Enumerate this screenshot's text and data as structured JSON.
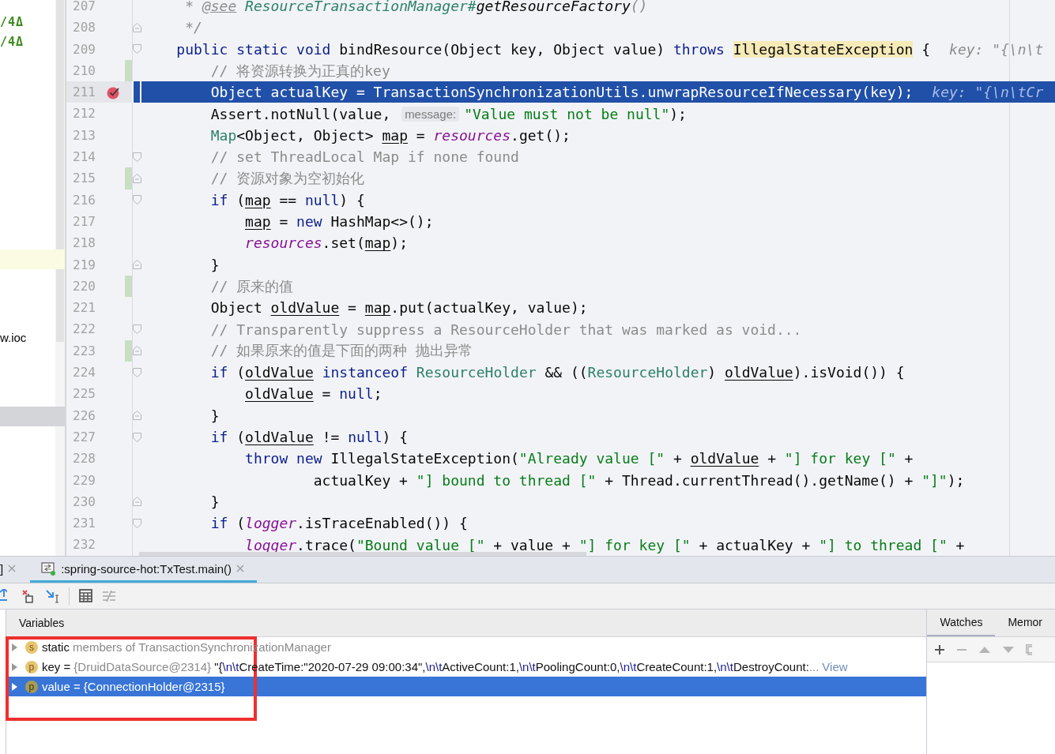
{
  "project_panel": {
    "rows": [
      {
        "text": "/4Δ",
        "current": false,
        "selected": false
      },
      {
        "text": "/4Δ",
        "current": false,
        "selected": false
      },
      {
        "current": true,
        "selected": false
      },
      {
        "text": "w.ioc",
        "current": false,
        "selected": false
      },
      {
        "current": false,
        "selected": true
      }
    ]
  },
  "editor": {
    "lines": [
      {
        "number": "207",
        "selected": false,
        "breakpoint": false,
        "changed": false,
        "fold_start": false,
        "fold_end": false,
        "tokens": [
          {
            "kind": "doc",
            "text": "     * "
          },
          {
            "kind": "doc-tag",
            "text": "@see"
          },
          {
            "kind": "doc-link",
            "text": " ResourceTransactionManager#"
          },
          {
            "kind": "doc-ref",
            "text": "getResourceFactory"
          },
          {
            "kind": "doc",
            "text": "()"
          }
        ]
      },
      {
        "number": "208",
        "selected": false,
        "breakpoint": false,
        "changed": false,
        "fold_start": false,
        "fold_end": true,
        "tokens": [
          {
            "kind": "doc",
            "text": "     */"
          }
        ]
      },
      {
        "number": "209",
        "selected": false,
        "breakpoint": false,
        "changed": false,
        "fold_start": true,
        "fold_end": false,
        "tokens": [
          {
            "kind": "keyword",
            "text": "    public static void"
          },
          {
            "kind": "plain",
            "text": " bindResource(Object key, Object value) "
          },
          {
            "kind": "keyword",
            "text": "throws "
          },
          {
            "kind": "match",
            "text": "IllegalStateException"
          },
          {
            "kind": "plain",
            "text": " {"
          },
          {
            "kind": "hint",
            "text": "key: \"{\\n\\t"
          }
        ]
      },
      {
        "number": "210",
        "selected": false,
        "breakpoint": false,
        "changed": true,
        "fold_start": false,
        "fold_end": false,
        "tokens": [
          {
            "kind": "comment",
            "text": "        // 将资源转换为正真的key"
          }
        ]
      },
      {
        "number": "211",
        "selected": true,
        "breakpoint": true,
        "changed": false,
        "fold_start": false,
        "fold_end": false,
        "tokens": [
          {
            "kind": "plain",
            "text": "        Object actualKey = TransactionSynchronizationUtils.unwrapResourceIfNecessary(key);"
          },
          {
            "kind": "hint",
            "text": "key: \"{\\n\\tCr"
          }
        ]
      },
      {
        "number": "212",
        "selected": false,
        "breakpoint": false,
        "changed": false,
        "fold_start": false,
        "fold_end": false,
        "tokens": [
          {
            "kind": "plain",
            "text": "        Assert.notNull(value, "
          },
          {
            "kind": "hint-box",
            "text": "message:"
          },
          {
            "kind": "string",
            "text": "\"Value must not be null\""
          },
          {
            "kind": "plain",
            "text": ");"
          }
        ]
      },
      {
        "number": "213",
        "selected": false,
        "breakpoint": false,
        "changed": false,
        "fold_start": false,
        "fold_end": false,
        "tokens": [
          {
            "kind": "type",
            "text": "        Map"
          },
          {
            "kind": "plain",
            "text": "<Object, Object> "
          },
          {
            "kind": "var",
            "text": "map"
          },
          {
            "kind": "plain",
            "text": " = "
          },
          {
            "kind": "field",
            "text": "resources"
          },
          {
            "kind": "plain",
            "text": ".get();"
          }
        ]
      },
      {
        "number": "214",
        "selected": false,
        "breakpoint": false,
        "changed": false,
        "fold_start": true,
        "fold_end": false,
        "tokens": [
          {
            "kind": "comment",
            "text": "        // set ThreadLocal Map if none found"
          }
        ]
      },
      {
        "number": "215",
        "selected": false,
        "breakpoint": false,
        "changed": true,
        "fold_start": false,
        "fold_end": true,
        "tokens": [
          {
            "kind": "comment",
            "text": "        // 资源对象为空初始化"
          }
        ]
      },
      {
        "number": "216",
        "selected": false,
        "breakpoint": false,
        "changed": false,
        "fold_start": true,
        "fold_end": false,
        "tokens": [
          {
            "kind": "keyword",
            "text": "        if"
          },
          {
            "kind": "plain",
            "text": " ("
          },
          {
            "kind": "var",
            "text": "map"
          },
          {
            "kind": "plain",
            "text": " == "
          },
          {
            "kind": "keyword",
            "text": "null"
          },
          {
            "kind": "plain",
            "text": ") {"
          }
        ]
      },
      {
        "number": "217",
        "selected": false,
        "breakpoint": false,
        "changed": false,
        "fold_start": false,
        "fold_end": false,
        "tokens": [
          {
            "kind": "var",
            "text": "            map"
          },
          {
            "kind": "plain",
            "text": " = "
          },
          {
            "kind": "keyword",
            "text": "new"
          },
          {
            "kind": "plain",
            "text": " HashMap<>();"
          }
        ]
      },
      {
        "number": "218",
        "selected": false,
        "breakpoint": false,
        "changed": false,
        "fold_start": false,
        "fold_end": false,
        "tokens": [
          {
            "kind": "field",
            "text": "            resources"
          },
          {
            "kind": "plain",
            "text": ".set("
          },
          {
            "kind": "var",
            "text": "map"
          },
          {
            "kind": "plain",
            "text": ");"
          }
        ]
      },
      {
        "number": "219",
        "selected": false,
        "breakpoint": false,
        "changed": false,
        "fold_start": false,
        "fold_end": true,
        "tokens": [
          {
            "kind": "plain",
            "text": "        }"
          }
        ]
      },
      {
        "number": "220",
        "selected": false,
        "breakpoint": false,
        "changed": true,
        "fold_start": false,
        "fold_end": false,
        "tokens": [
          {
            "kind": "comment",
            "text": "        // 原来的值"
          }
        ]
      },
      {
        "number": "221",
        "selected": false,
        "breakpoint": false,
        "changed": false,
        "fold_start": false,
        "fold_end": false,
        "tokens": [
          {
            "kind": "plain",
            "text": "        Object "
          },
          {
            "kind": "var",
            "text": "oldValue"
          },
          {
            "kind": "plain",
            "text": " = "
          },
          {
            "kind": "var",
            "text": "map"
          },
          {
            "kind": "plain",
            "text": ".put(actualKey, value);"
          }
        ]
      },
      {
        "number": "222",
        "selected": false,
        "breakpoint": false,
        "changed": false,
        "fold_start": true,
        "fold_end": false,
        "tokens": [
          {
            "kind": "comment",
            "text": "        // Transparently suppress a ResourceHolder that was marked as void..."
          }
        ]
      },
      {
        "number": "223",
        "selected": false,
        "breakpoint": false,
        "changed": true,
        "fold_start": false,
        "fold_end": true,
        "tokens": [
          {
            "kind": "comment",
            "text": "        // 如果原来的值是下面的两种 抛出异常"
          }
        ]
      },
      {
        "number": "224",
        "selected": false,
        "breakpoint": false,
        "changed": false,
        "fold_start": true,
        "fold_end": false,
        "tokens": [
          {
            "kind": "keyword",
            "text": "        if"
          },
          {
            "kind": "plain",
            "text": " ("
          },
          {
            "kind": "var",
            "text": "oldValue"
          },
          {
            "kind": "keyword",
            "text": " instanceof "
          },
          {
            "kind": "type",
            "text": "ResourceHolder"
          },
          {
            "kind": "plain",
            "text": " && (("
          },
          {
            "kind": "type",
            "text": "ResourceHolder"
          },
          {
            "kind": "plain",
            "text": ") "
          },
          {
            "kind": "var",
            "text": "oldValue"
          },
          {
            "kind": "plain",
            "text": ").isVoid()) {"
          }
        ]
      },
      {
        "number": "225",
        "selected": false,
        "breakpoint": false,
        "changed": false,
        "fold_start": false,
        "fold_end": false,
        "tokens": [
          {
            "kind": "var",
            "text": "            oldValue"
          },
          {
            "kind": "plain",
            "text": " = "
          },
          {
            "kind": "keyword",
            "text": "null"
          },
          {
            "kind": "plain",
            "text": ";"
          }
        ]
      },
      {
        "number": "226",
        "selected": false,
        "breakpoint": false,
        "changed": false,
        "fold_start": false,
        "fold_end": true,
        "tokens": [
          {
            "kind": "plain",
            "text": "        }"
          }
        ]
      },
      {
        "number": "227",
        "selected": false,
        "breakpoint": false,
        "changed": false,
        "fold_start": true,
        "fold_end": false,
        "tokens": [
          {
            "kind": "keyword",
            "text": "        if"
          },
          {
            "kind": "plain",
            "text": " ("
          },
          {
            "kind": "var",
            "text": "oldValue"
          },
          {
            "kind": "plain",
            "text": " != "
          },
          {
            "kind": "keyword",
            "text": "null"
          },
          {
            "kind": "plain",
            "text": ") {"
          }
        ]
      },
      {
        "number": "228",
        "selected": false,
        "breakpoint": false,
        "changed": false,
        "fold_start": false,
        "fold_end": false,
        "tokens": [
          {
            "kind": "keyword",
            "text": "            throw new"
          },
          {
            "kind": "plain",
            "text": " IllegalStateException("
          },
          {
            "kind": "string",
            "text": "\"Already value [\""
          },
          {
            "kind": "plain",
            "text": " + "
          },
          {
            "kind": "var",
            "text": "oldValue"
          },
          {
            "kind": "plain",
            "text": " + "
          },
          {
            "kind": "string",
            "text": "\"] for key [\""
          },
          {
            "kind": "plain",
            "text": " +"
          }
        ]
      },
      {
        "number": "229",
        "selected": false,
        "breakpoint": false,
        "changed": false,
        "fold_start": false,
        "fold_end": false,
        "tokens": [
          {
            "kind": "plain",
            "text": "                    actualKey + "
          },
          {
            "kind": "string",
            "text": "\"] bound to thread [\""
          },
          {
            "kind": "plain",
            "text": " + Thread.currentThread().getName() + "
          },
          {
            "kind": "string",
            "text": "\"]\""
          },
          {
            "kind": "plain",
            "text": ");"
          }
        ]
      },
      {
        "number": "230",
        "selected": false,
        "breakpoint": false,
        "changed": false,
        "fold_start": false,
        "fold_end": true,
        "tokens": [
          {
            "kind": "plain",
            "text": "        }"
          }
        ]
      },
      {
        "number": "231",
        "selected": false,
        "breakpoint": false,
        "changed": false,
        "fold_start": true,
        "fold_end": false,
        "tokens": [
          {
            "kind": "keyword",
            "text": "        if"
          },
          {
            "kind": "plain",
            "text": " ("
          },
          {
            "kind": "field",
            "text": "logger"
          },
          {
            "kind": "plain",
            "text": ".isTraceEnabled()) {"
          }
        ]
      },
      {
        "number": "232",
        "selected": false,
        "breakpoint": false,
        "changed": false,
        "fold_start": false,
        "fold_end": false,
        "tokens": [
          {
            "kind": "field",
            "text": "            logger"
          },
          {
            "kind": "plain",
            "text": ".trace("
          },
          {
            "kind": "string",
            "text": "\"Bound value [\""
          },
          {
            "kind": "plain",
            "text": " + value + "
          },
          {
            "kind": "string",
            "text": "\"] for key [\""
          },
          {
            "kind": "plain",
            "text": " + actualKey + "
          },
          {
            "kind": "string",
            "text": "\"] to thread [\""
          },
          {
            "kind": "plain",
            "text": " +"
          }
        ]
      }
    ]
  },
  "debug": {
    "tabs": [
      {
        "label": "]",
        "selected": false
      },
      {
        "label": ":spring-source-hot:TxTest.main()",
        "selected": true
      }
    ],
    "variables": {
      "title": "Variables",
      "rows": [
        {
          "badge": "s",
          "expanded": false,
          "selected": false,
          "tokens": [
            {
              "kind": "name",
              "text": "static"
            },
            {
              "kind": "gray",
              "text": " members of TransactionSynchronizationManager"
            }
          ]
        },
        {
          "badge": "p",
          "expanded": false,
          "selected": false,
          "tokens": [
            {
              "kind": "name",
              "text": "key"
            },
            {
              "kind": "plain",
              "text": " = "
            },
            {
              "kind": "gray",
              "text": "{DruidDataSource@2314}"
            },
            {
              "kind": "plain",
              "text": " \"{"
            },
            {
              "kind": "escape",
              "text": "\\n\\t"
            },
            {
              "kind": "plain",
              "text": "CreateTime:\"2020-07-29 09:00:34\","
            },
            {
              "kind": "escape",
              "text": "\\n\\t"
            },
            {
              "kind": "plain",
              "text": "ActiveCount:1,"
            },
            {
              "kind": "escape",
              "text": "\\n\\t"
            },
            {
              "kind": "plain",
              "text": "PoolingCount:0,"
            },
            {
              "kind": "escape",
              "text": "\\n\\t"
            },
            {
              "kind": "plain",
              "text": "CreateCount:1,"
            },
            {
              "kind": "escape",
              "text": "\\n\\t"
            },
            {
              "kind": "plain",
              "text": "DestroyCount:"
            },
            {
              "kind": "gray",
              "text": "..."
            },
            {
              "kind": "link",
              "text": "View"
            }
          ]
        },
        {
          "badge": "p",
          "expanded": false,
          "selected": true,
          "tokens": [
            {
              "kind": "name",
              "text": "value"
            },
            {
              "kind": "plain",
              "text": " = {ConnectionHolder@2315}"
            }
          ]
        }
      ]
    },
    "side_tabs": [
      {
        "label": "Watches",
        "selected": true
      },
      {
        "label": "Memor",
        "selected": false
      }
    ]
  }
}
